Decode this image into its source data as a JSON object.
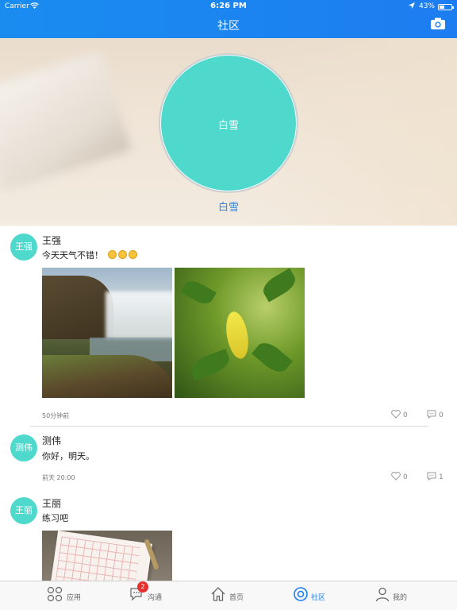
{
  "status_bar": {
    "carrier": "Carrier",
    "time": "6:26 PM",
    "battery": "43%"
  },
  "nav": {
    "title": "社区",
    "camera_icon": "camera-icon"
  },
  "profile": {
    "avatar_text": "白雪",
    "name": "白雪",
    "avatar_color": "#4ed9cc"
  },
  "posts": [
    {
      "avatar_text": "王强",
      "name": "王强",
      "text": "今天天气不错！",
      "emoji_count": 3,
      "time": "50分钟前",
      "likes": "0",
      "comments": "0",
      "images": [
        "waterfall",
        "leaves"
      ]
    },
    {
      "avatar_text": "测伟",
      "name": "测伟",
      "text": "你好，明天。",
      "time": "前天  20:00",
      "likes": "0",
      "comments": "1"
    },
    {
      "avatar_text": "王丽",
      "name": "王丽",
      "text": "练习吧",
      "images": [
        "paper"
      ]
    }
  ],
  "tabs": [
    {
      "label": "应用",
      "icon": "apps-icon",
      "active": false
    },
    {
      "label": "沟通",
      "icon": "chat-icon",
      "active": false,
      "badge": "2"
    },
    {
      "label": "首页",
      "icon": "home-icon",
      "active": false
    },
    {
      "label": "社区",
      "icon": "community-icon",
      "active": true
    },
    {
      "label": "我的",
      "icon": "profile-icon",
      "active": false
    }
  ],
  "colors": {
    "accent": "#1c7df0",
    "avatar": "#4ed9cc",
    "badge": "#e53030"
  }
}
